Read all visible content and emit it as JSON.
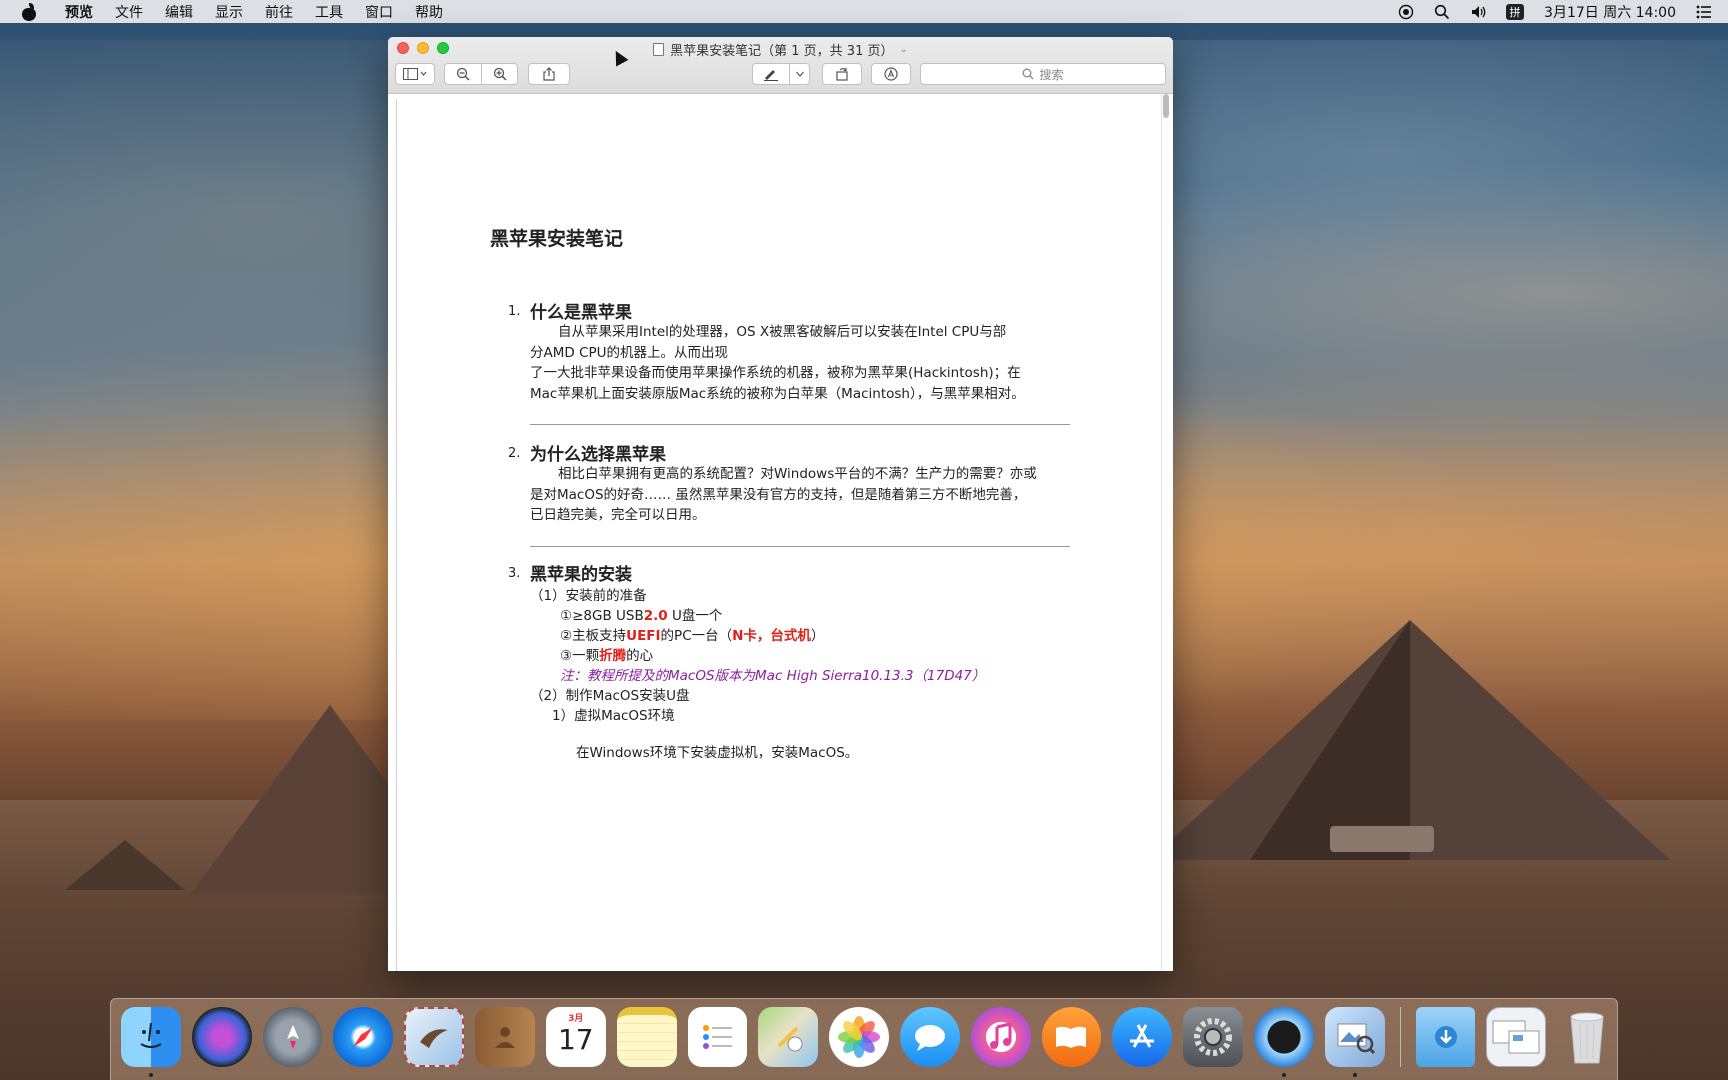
{
  "menubar": {
    "app_name": "预览",
    "items": [
      "文件",
      "编辑",
      "显示",
      "前往",
      "工具",
      "窗口",
      "帮助"
    ],
    "ime": "拼",
    "clock": "3月17日 周六 14:00"
  },
  "window": {
    "title": "黑苹果安装笔记（第 1 页，共 31 页）",
    "search_placeholder": "搜索"
  },
  "document": {
    "title": "黑苹果安装笔记",
    "sections": [
      {
        "num": "1.",
        "heading": "什么是黑苹果",
        "lines": [
          "自从苹果采用Intel的处理器，OS X被黑客破解后可以安装在Intel CPU与部",
          "分AMD CPU的机器上。从而出现",
          "了一大批非苹果设备而使用苹果操作系统的机器，被称为黑苹果(Hackintosh)；在",
          "Mac苹果机上面安装原版Mac系统的被称为白苹果（Macintosh），与黑苹果相对。"
        ]
      },
      {
        "num": "2.",
        "heading": "为什么选择黑苹果",
        "lines": [
          "相比白苹果拥有更高的系统配置？对Windows平台的不满？生产力的需要？亦或",
          "是对MacOS的好奇……  虽然黑苹果没有官方的支持，但是随着第三方不断地完善，",
          "已日趋完美，完全可以日用。"
        ]
      },
      {
        "num": "3.",
        "heading": "黑苹果的安装"
      }
    ],
    "install": {
      "prep": "（1）安装前的准备",
      "item1_pre": "①≥8GB USB",
      "item1_red": "2.0",
      "item1_post": " U盘一个",
      "item2_pre": "②主板支持",
      "item2_red": "UEFI",
      "item2_mid": "的PC一台（",
      "item2_red2": "N卡，台式机",
      "item2_post": "）",
      "item3_pre": "③一颗",
      "item3_red": "折腾",
      "item3_post": "的心",
      "note": "注：教程所提及的MacOS版本为Mac High Sierra10.13.3（17D47）",
      "make": "（2）制作MacOS安装U盘",
      "vm": "1）虚拟MacOS环境",
      "vm_text": "在Windows环境下安装虚拟机，安装MacOS。"
    }
  },
  "dock": {
    "calendar_month": "3月",
    "calendar_day": "17",
    "apps": [
      "finder",
      "siri",
      "launchpad",
      "safari",
      "mail",
      "contacts",
      "calendar",
      "notes",
      "reminders",
      "maps",
      "photos",
      "messages",
      "itunes",
      "ibooks",
      "app-store",
      "system-preferences",
      "quicktime",
      "preview",
      "downloads",
      "recent-documents",
      "trash"
    ]
  }
}
